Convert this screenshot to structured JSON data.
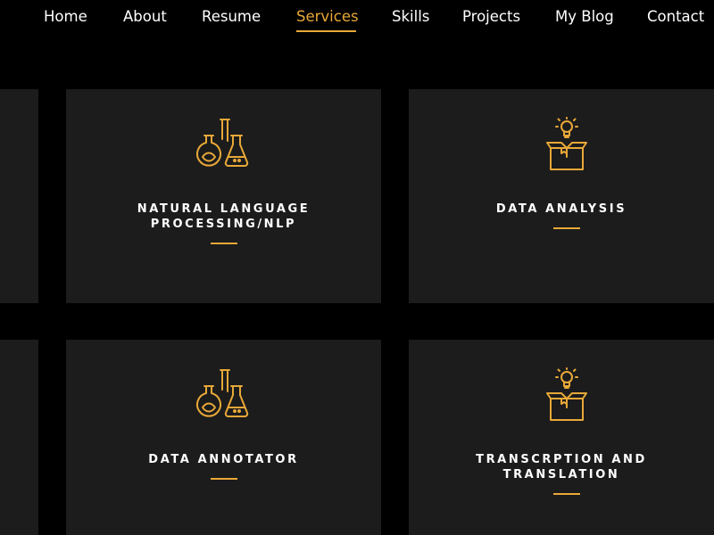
{
  "nav": {
    "items": [
      {
        "label": "Home"
      },
      {
        "label": "About"
      },
      {
        "label": "Resume"
      },
      {
        "label": "Services",
        "active": true
      },
      {
        "label": "Skills"
      },
      {
        "label": "Projects"
      },
      {
        "label": "My Blog"
      },
      {
        "label": "Contact"
      }
    ]
  },
  "services": {
    "items": [
      {
        "title_line1": "NATURAL LANGUAGE",
        "title_line2": "PROCESSING/NLP",
        "icon": "flasks-icon"
      },
      {
        "title_line1": "DATA ANALYSIS",
        "title_line2": "",
        "icon": "idea-box-icon"
      },
      {
        "title_line1": "DATA ANNOTATOR",
        "title_line2": "",
        "icon": "flasks-icon"
      },
      {
        "title_line1": "TRANSCRPTION AND",
        "title_line2": "TRANSLATION",
        "icon": "idea-box-icon"
      }
    ]
  },
  "colors": {
    "accent": "#e8a838",
    "card_bg": "#1c1c1c",
    "page_bg": "#000000",
    "text": "#ffffff"
  }
}
